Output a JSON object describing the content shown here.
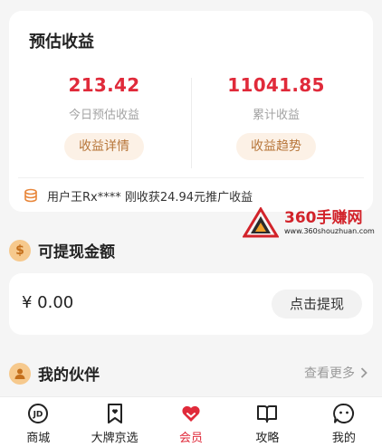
{
  "earnings": {
    "title": "预估收益",
    "today": {
      "value": "213.42",
      "label": "今日预估收益",
      "button": "收益详情"
    },
    "total": {
      "value": "11041.85",
      "label": "累计收益",
      "button": "收益趋势"
    },
    "ticker": "用户王Rx**** 刚收获24.94元推广收益",
    "ticker_icon": "coin-stack-icon"
  },
  "watermark": {
    "brand": "360手赚网",
    "url": "www.360shouzhuan.com"
  },
  "withdraw": {
    "title": "可提现金额",
    "icon_glyph": "$",
    "amount": "¥ 0.00",
    "button": "点击提现"
  },
  "partners": {
    "title": "我的伙伴",
    "more": "查看更多"
  },
  "nav": {
    "items": [
      {
        "label": "商城",
        "icon": "jd-icon",
        "active": false
      },
      {
        "label": "大牌京选",
        "icon": "bookmark-heart-icon",
        "active": false
      },
      {
        "label": "会员",
        "icon": "heart-icon",
        "active": true
      },
      {
        "label": "攻略",
        "icon": "book-icon",
        "active": false
      },
      {
        "label": "我的",
        "icon": "chat-face-icon",
        "active": false
      }
    ]
  },
  "colors": {
    "accent": "#e02a3a",
    "pill_bg": "#fcf1e6",
    "pill_text": "#b7763a",
    "background": "#f5f5f5"
  }
}
